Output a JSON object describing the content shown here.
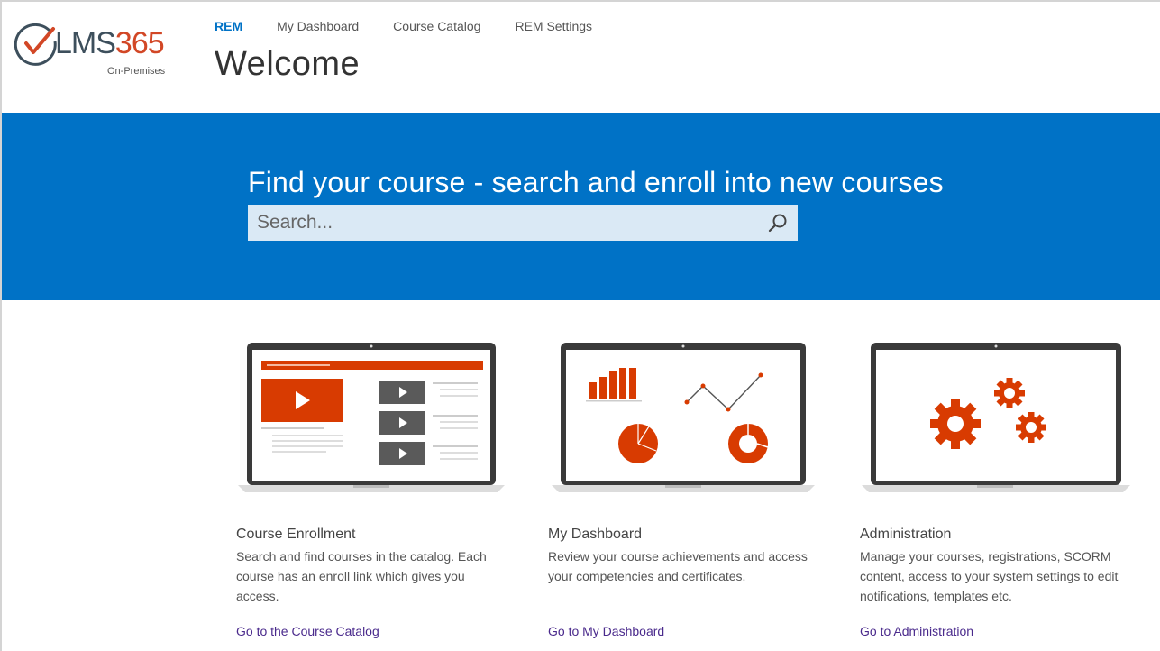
{
  "logo": {
    "brand_main": "LMS",
    "brand_num": "365",
    "subtitle": "On-Premises"
  },
  "nav": {
    "items": [
      {
        "label": "REM",
        "active": true
      },
      {
        "label": "My Dashboard",
        "active": false
      },
      {
        "label": "Course Catalog",
        "active": false
      },
      {
        "label": "REM Settings",
        "active": false
      }
    ]
  },
  "page": {
    "title": "Welcome"
  },
  "hero": {
    "title": "Find your course - search and enroll into new courses",
    "search_placeholder": "Search...",
    "search_value": ""
  },
  "cards": [
    {
      "title": "Course Enrollment",
      "description": "Search and find courses in the catalog. Each course has an enroll link which gives you access.",
      "link": "Go to the Course Catalog",
      "icon": "course-catalog-illustration"
    },
    {
      "title": "My Dashboard",
      "description": "Review your course achievements and access your competencies and certificates.",
      "link": "Go to My Dashboard",
      "icon": "dashboard-charts-illustration"
    },
    {
      "title": "Administration",
      "description": "Manage your courses, registrations, SCORM content, access to your system settings to edit notifications, templates etc.",
      "link": "Go to Administration",
      "icon": "gears-illustration"
    }
  ],
  "colors": {
    "brand_blue": "#0072c6",
    "accent_orange": "#d83b01",
    "link_purple": "#4a2a8c",
    "search_bg": "#dae9f5"
  }
}
